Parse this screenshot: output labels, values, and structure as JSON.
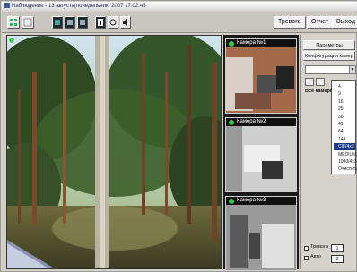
{
  "window": {
    "title": "Наблюдение - 13 августа(понедельник) 2007 17:02:45"
  },
  "toolbar": {
    "buttons": [
      {
        "name": "layout-grid-icon"
      },
      {
        "name": "layout-single-icon"
      },
      {
        "name": "view-1-icon"
      },
      {
        "name": "view-2-icon"
      },
      {
        "name": "view-3-icon"
      },
      {
        "name": "info-icon"
      },
      {
        "name": "record-icon"
      },
      {
        "name": "sound-icon"
      }
    ],
    "alarm_label": "Тревога",
    "report_label": "Отчет",
    "exit_label": "Выход"
  },
  "main_camera": {
    "indicator_color": "#36c84a"
  },
  "thumbnails": [
    {
      "label": "Камера №1"
    },
    {
      "label": "Камера №2"
    },
    {
      "label": "Камера №3"
    }
  ],
  "right_panel": {
    "parameters_label": "Параметры",
    "configuration_label": "Конфигурация камер",
    "all_cameras_label": "Все камеры",
    "dropdown_items": [
      "4",
      "9",
      "16",
      "25",
      "36",
      "49",
      "64",
      "144",
      "CIF/4x3",
      "MEDIUM",
      "1080/4x3",
      "Очистить"
    ],
    "selected_index": 8,
    "checkbox1_label": "Тревога",
    "checkbox2_label": "Авто",
    "spin1_value": "1",
    "spin2_value": "2"
  }
}
